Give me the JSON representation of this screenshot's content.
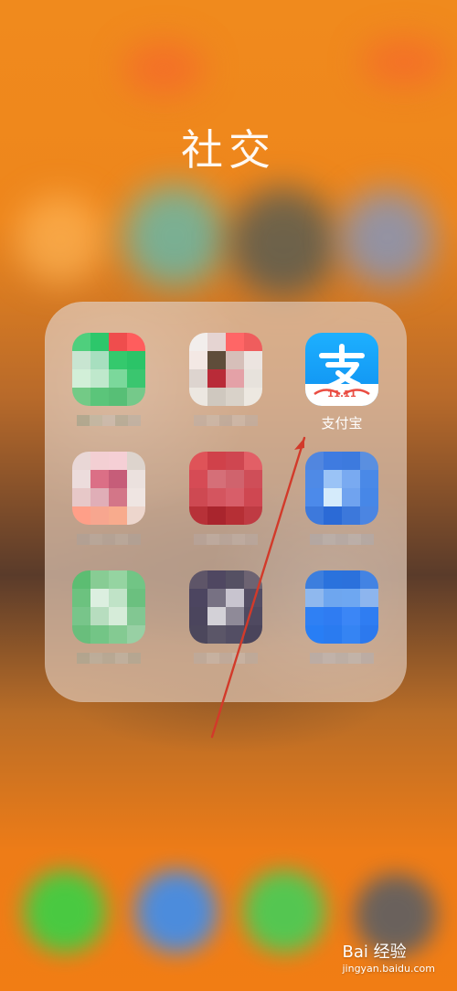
{
  "folder": {
    "title": "社交"
  },
  "apps": [
    {
      "label": "",
      "icon_name": "green-chat-app-icon",
      "pixels": [
        "#4fcf7d",
        "#2dc76b",
        "#ef4d4d",
        "#ff5d5d",
        "#c8e5d1",
        "#a7dfbf",
        "#34c96d",
        "#2bc468",
        "#d2efd8",
        "#bfe8cc",
        "#7bd89b",
        "#3ac66f",
        "#73ca86",
        "#5bc57a",
        "#57bf76",
        "#75c98a"
      ],
      "caption": [
        "#8c9c85",
        "#b1bbab",
        "#c3c2be",
        "#9aa595",
        "#aeb0ab"
      ]
    },
    {
      "label": "",
      "icon_name": "shopping-app-icon",
      "pixels": [
        "#f2eeec",
        "#e5d4d2",
        "#ff6666",
        "#ef5d5d",
        "#f3e8e4",
        "#5f4d3a",
        "#d6bfb9",
        "#ece4e0",
        "#ddd4cf",
        "#b92b38",
        "#e4a1a7",
        "#e7e2dc",
        "#ece7e1",
        "#cfc8bf",
        "#d9d2c9",
        "#ede8e1"
      ],
      "caption": [
        "#b8b1ad",
        "#c8c1bd",
        "#b2aca9",
        "#cbc5c2",
        "#b9b3b0"
      ]
    },
    {
      "label": "支付宝",
      "icon_name": "alipay-icon",
      "pixels": [],
      "caption": []
    },
    {
      "label": "",
      "icon_name": "pink-app-icon",
      "pixels": [
        "#e9d7d6",
        "#f3cfd3",
        "#f5cfd5",
        "#ddd4cd",
        "#ecdcdc",
        "#db6f86",
        "#c65d79",
        "#ebe1de",
        "#e7c8c8",
        "#e0aeb7",
        "#d37688",
        "#efe5e2",
        "#ff9f88",
        "#f7a68f",
        "#f8ab8d",
        "#edd6cd"
      ],
      "caption": [
        "#a9a39e",
        "#b6b0ab",
        "#aca6a1",
        "#b8b2ad",
        "#aaa49f"
      ]
    },
    {
      "label": "",
      "icon_name": "red-app-icon",
      "pixels": [
        "#df5358",
        "#d0414a",
        "#cf4650",
        "#e25f66",
        "#d64b55",
        "#d56f78",
        "#d0636d",
        "#cf4e58",
        "#ce4952",
        "#d4555f",
        "#d85e69",
        "#cf4751",
        "#b73138",
        "#a9252d",
        "#b62f35",
        "#bf3b43"
      ],
      "caption": [
        "#b7aaa6",
        "#c5bab6",
        "#b9aeaa",
        "#c4bab7",
        "#b8aeaa"
      ]
    },
    {
      "label": "",
      "icon_name": "blue-app-icon",
      "pixels": [
        "#5186df",
        "#3f7be0",
        "#3d7ade",
        "#5a8fe0",
        "#4f8ae6",
        "#9ac3f6",
        "#79aaf1",
        "#4a89e7",
        "#4c8aea",
        "#d5ebfb",
        "#70a3ef",
        "#4787e7",
        "#3d79dc",
        "#2b6ad6",
        "#3c78db",
        "#4b85e2"
      ],
      "caption": [
        "#a8acb5",
        "#b6bac1",
        "#acb0b8",
        "#b8bcc3",
        "#aaaeb6"
      ]
    },
    {
      "label": "",
      "icon_name": "green-card-app-icon",
      "pixels": [
        "#5cbd72",
        "#88cc94",
        "#95d4a1",
        "#71c585",
        "#6cc27f",
        "#dcefe0",
        "#c0e3c7",
        "#6bc07f",
        "#78c58a",
        "#b7ddbf",
        "#d6ecd9",
        "#82c792",
        "#69be7c",
        "#73c586",
        "#84ca92",
        "#98d0a4"
      ],
      "caption": [
        "#9aa493",
        "#b0b6ab",
        "#a4ac9d",
        "#b7bcb1",
        "#a1a99a"
      ]
    },
    {
      "label": "",
      "icon_name": "dark-app-icon",
      "pixels": [
        "#5e5568",
        "#4f4761",
        "#555063",
        "#6d6372",
        "#4c4560",
        "#777183",
        "#c8c4cf",
        "#544d64",
        "#4b455d",
        "#d3d1d7",
        "#8f8a98",
        "#4f4960",
        "#4c475c",
        "#5b5668",
        "#534e64",
        "#4a445b"
      ],
      "caption": [
        "#b7aea8",
        "#c8c0ba",
        "#b8b0aa",
        "#c7bfb9",
        "#b5ada7"
      ]
    },
    {
      "label": "",
      "icon_name": "blue-list-app-icon",
      "pixels": [
        "#3c7ede",
        "#2a72dd",
        "#2b71dc",
        "#4383e3",
        "#8fb8ee",
        "#6ea6ef",
        "#6ea7f1",
        "#8db5ee",
        "#2f80f4",
        "#2f7cf2",
        "#3b86f6",
        "#2f7df2",
        "#287ef5",
        "#2a7bf0",
        "#3584f3",
        "#2c79ee"
      ],
      "caption": [
        "#aab0ba",
        "#b7bdc6",
        "#adb3bd",
        "#b9bec6",
        "#aab0ba"
      ]
    }
  ],
  "watermark": {
    "main": "Bai 经验",
    "sub": "jingyan.baidu.com"
  },
  "colors": {
    "arrow": "#d23a2a"
  }
}
